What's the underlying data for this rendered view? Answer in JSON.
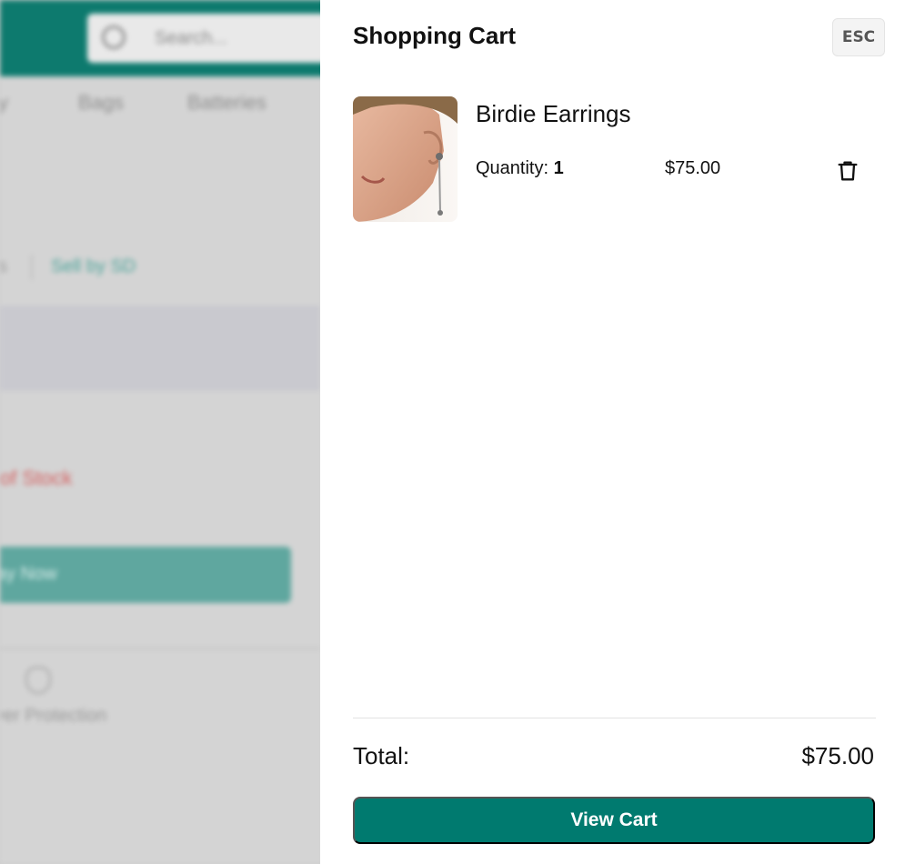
{
  "background": {
    "search_placeholder": "Search...",
    "nav_items": [
      "ty",
      "Bags",
      "Batteries"
    ],
    "link_tiny": "s",
    "link_text": "Sell by SD",
    "stock_text": "of Stock",
    "button_text": "ay Now",
    "protection_text": "yer Protection"
  },
  "cart": {
    "title": "Shopping Cart",
    "close_label": "ESC",
    "items": [
      {
        "name": "Birdie Earrings",
        "quantity_label": "Quantity: ",
        "quantity": "1",
        "price": "$75.00",
        "delete_icon": "trash-icon"
      }
    ],
    "total_label": "Total:",
    "total_value": "$75.00",
    "view_cart_label": "View Cart"
  },
  "colors": {
    "accent": "#007a6f",
    "header_bg": "#0d7a6e"
  }
}
